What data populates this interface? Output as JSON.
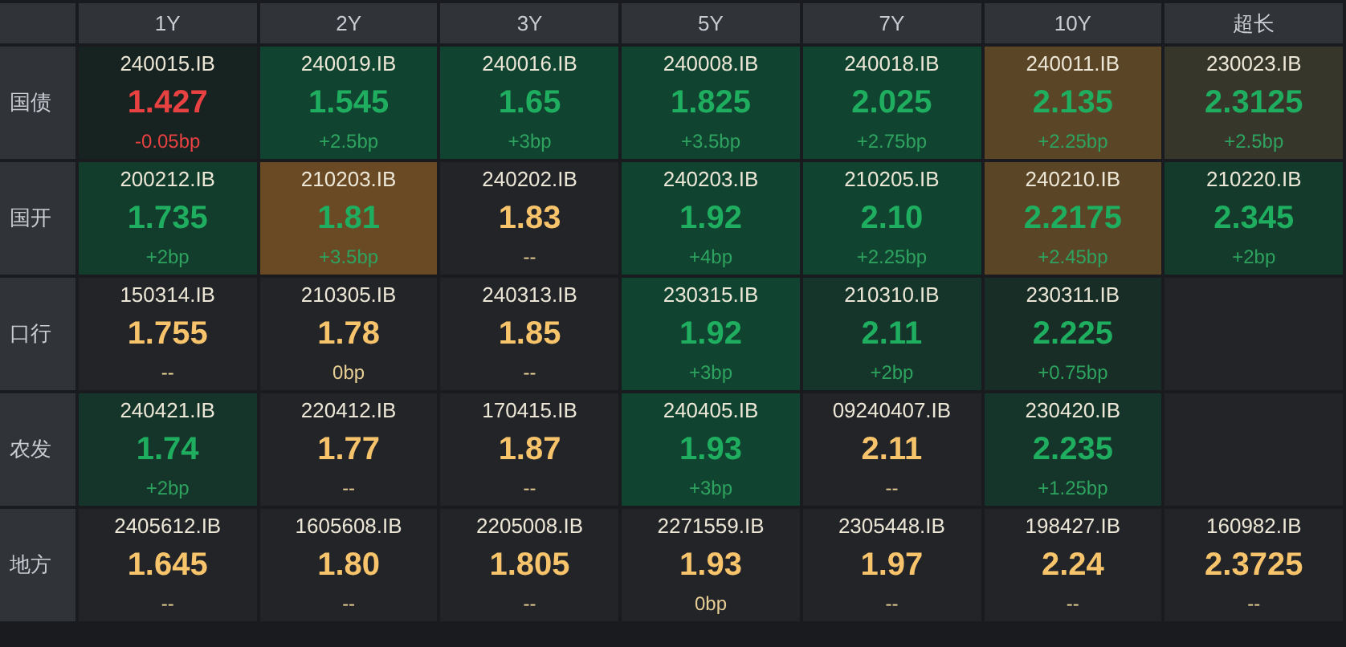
{
  "columns": [
    "1Y",
    "2Y",
    "3Y",
    "5Y",
    "7Y",
    "10Y",
    "超长"
  ],
  "rows": [
    {
      "label": "国债",
      "cells": [
        {
          "code": "240015.IB",
          "yield": "1.427",
          "change": "-0.05bp",
          "kind": "down",
          "color": "#172320"
        },
        {
          "code": "240019.IB",
          "yield": "1.545",
          "change": "+2.5bp",
          "kind": "up",
          "color": "#114430"
        },
        {
          "code": "240016.IB",
          "yield": "1.65",
          "change": "+3bp",
          "kind": "up",
          "color": "#114430"
        },
        {
          "code": "240008.IB",
          "yield": "1.825",
          "change": "+3.5bp",
          "kind": "up",
          "color": "#114430"
        },
        {
          "code": "240018.IB",
          "yield": "2.025",
          "change": "+2.75bp",
          "kind": "up",
          "color": "#114430"
        },
        {
          "code": "240011.IB",
          "yield": "2.135",
          "change": "+2.25bp",
          "kind": "up",
          "color": "#5a4526"
        },
        {
          "code": "230023.IB",
          "yield": "2.3125",
          "change": "+2.5bp",
          "kind": "up",
          "color": "#36372a"
        }
      ]
    },
    {
      "label": "国开",
      "cells": [
        {
          "code": "200212.IB",
          "yield": "1.735",
          "change": "+2bp",
          "kind": "up",
          "color": "#123c2c"
        },
        {
          "code": "210203.IB",
          "yield": "1.81",
          "change": "+3.5bp",
          "kind": "up",
          "color": "#694a24"
        },
        {
          "code": "240202.IB",
          "yield": "1.83",
          "change": "--",
          "kind": "flat",
          "color": "#222428"
        },
        {
          "code": "240203.IB",
          "yield": "1.92",
          "change": "+4bp",
          "kind": "up",
          "color": "#114430"
        },
        {
          "code": "210205.IB",
          "yield": "2.10",
          "change": "+2.25bp",
          "kind": "up",
          "color": "#114430"
        },
        {
          "code": "240210.IB",
          "yield": "2.2175",
          "change": "+2.45bp",
          "kind": "up",
          "color": "#5a4526"
        },
        {
          "code": "210220.IB",
          "yield": "2.345",
          "change": "+2bp",
          "kind": "up",
          "color": "#133a2b"
        }
      ]
    },
    {
      "label": "口行",
      "cells": [
        {
          "code": "150314.IB",
          "yield": "1.755",
          "change": "--",
          "kind": "flat",
          "color": "#222428"
        },
        {
          "code": "210305.IB",
          "yield": "1.78",
          "change": "0bp",
          "kind": "flat",
          "color": "#222428"
        },
        {
          "code": "240313.IB",
          "yield": "1.85",
          "change": "--",
          "kind": "flat",
          "color": "#222428"
        },
        {
          "code": "230315.IB",
          "yield": "1.92",
          "change": "+3bp",
          "kind": "up",
          "color": "#114430"
        },
        {
          "code": "210310.IB",
          "yield": "2.11",
          "change": "+2bp",
          "kind": "up",
          "color": "#15352a"
        },
        {
          "code": "230311.IB",
          "yield": "2.225",
          "change": "+0.75bp",
          "kind": "up",
          "color": "#172d26"
        },
        {
          "color": "#222428"
        }
      ]
    },
    {
      "label": "农发",
      "cells": [
        {
          "code": "240421.IB",
          "yield": "1.74",
          "change": "+2bp",
          "kind": "up",
          "color": "#15352a"
        },
        {
          "code": "220412.IB",
          "yield": "1.77",
          "change": "--",
          "kind": "flat",
          "color": "#222428"
        },
        {
          "code": "170415.IB",
          "yield": "1.87",
          "change": "--",
          "kind": "flat",
          "color": "#222428"
        },
        {
          "code": "240405.IB",
          "yield": "1.93",
          "change": "+3bp",
          "kind": "up",
          "color": "#114430"
        },
        {
          "code": "09240407.IB",
          "yield": "2.11",
          "change": "--",
          "kind": "flat",
          "color": "#222428"
        },
        {
          "code": "230420.IB",
          "yield": "2.235",
          "change": "+1.25bp",
          "kind": "up",
          "color": "#15352a"
        },
        {
          "color": "#222428"
        }
      ]
    },
    {
      "label": "地方",
      "cells": [
        {
          "code": "2405612.IB",
          "yield": "1.645",
          "change": "--",
          "kind": "flat",
          "color": "#222428"
        },
        {
          "code": "1605608.IB",
          "yield": "1.80",
          "change": "--",
          "kind": "flat",
          "color": "#222428"
        },
        {
          "code": "2205008.IB",
          "yield": "1.805",
          "change": "--",
          "kind": "flat",
          "color": "#222428"
        },
        {
          "code": "2271559.IB",
          "yield": "1.93",
          "change": "0bp",
          "kind": "flat",
          "color": "#222428"
        },
        {
          "code": "2305448.IB",
          "yield": "1.97",
          "change": "--",
          "kind": "flat",
          "color": "#222428"
        },
        {
          "code": "198427.IB",
          "yield": "2.24",
          "change": "--",
          "kind": "flat",
          "color": "#222428"
        },
        {
          "code": "160982.IB",
          "yield": "2.3725",
          "change": "--",
          "kind": "flat",
          "color": "#222428"
        }
      ]
    }
  ]
}
